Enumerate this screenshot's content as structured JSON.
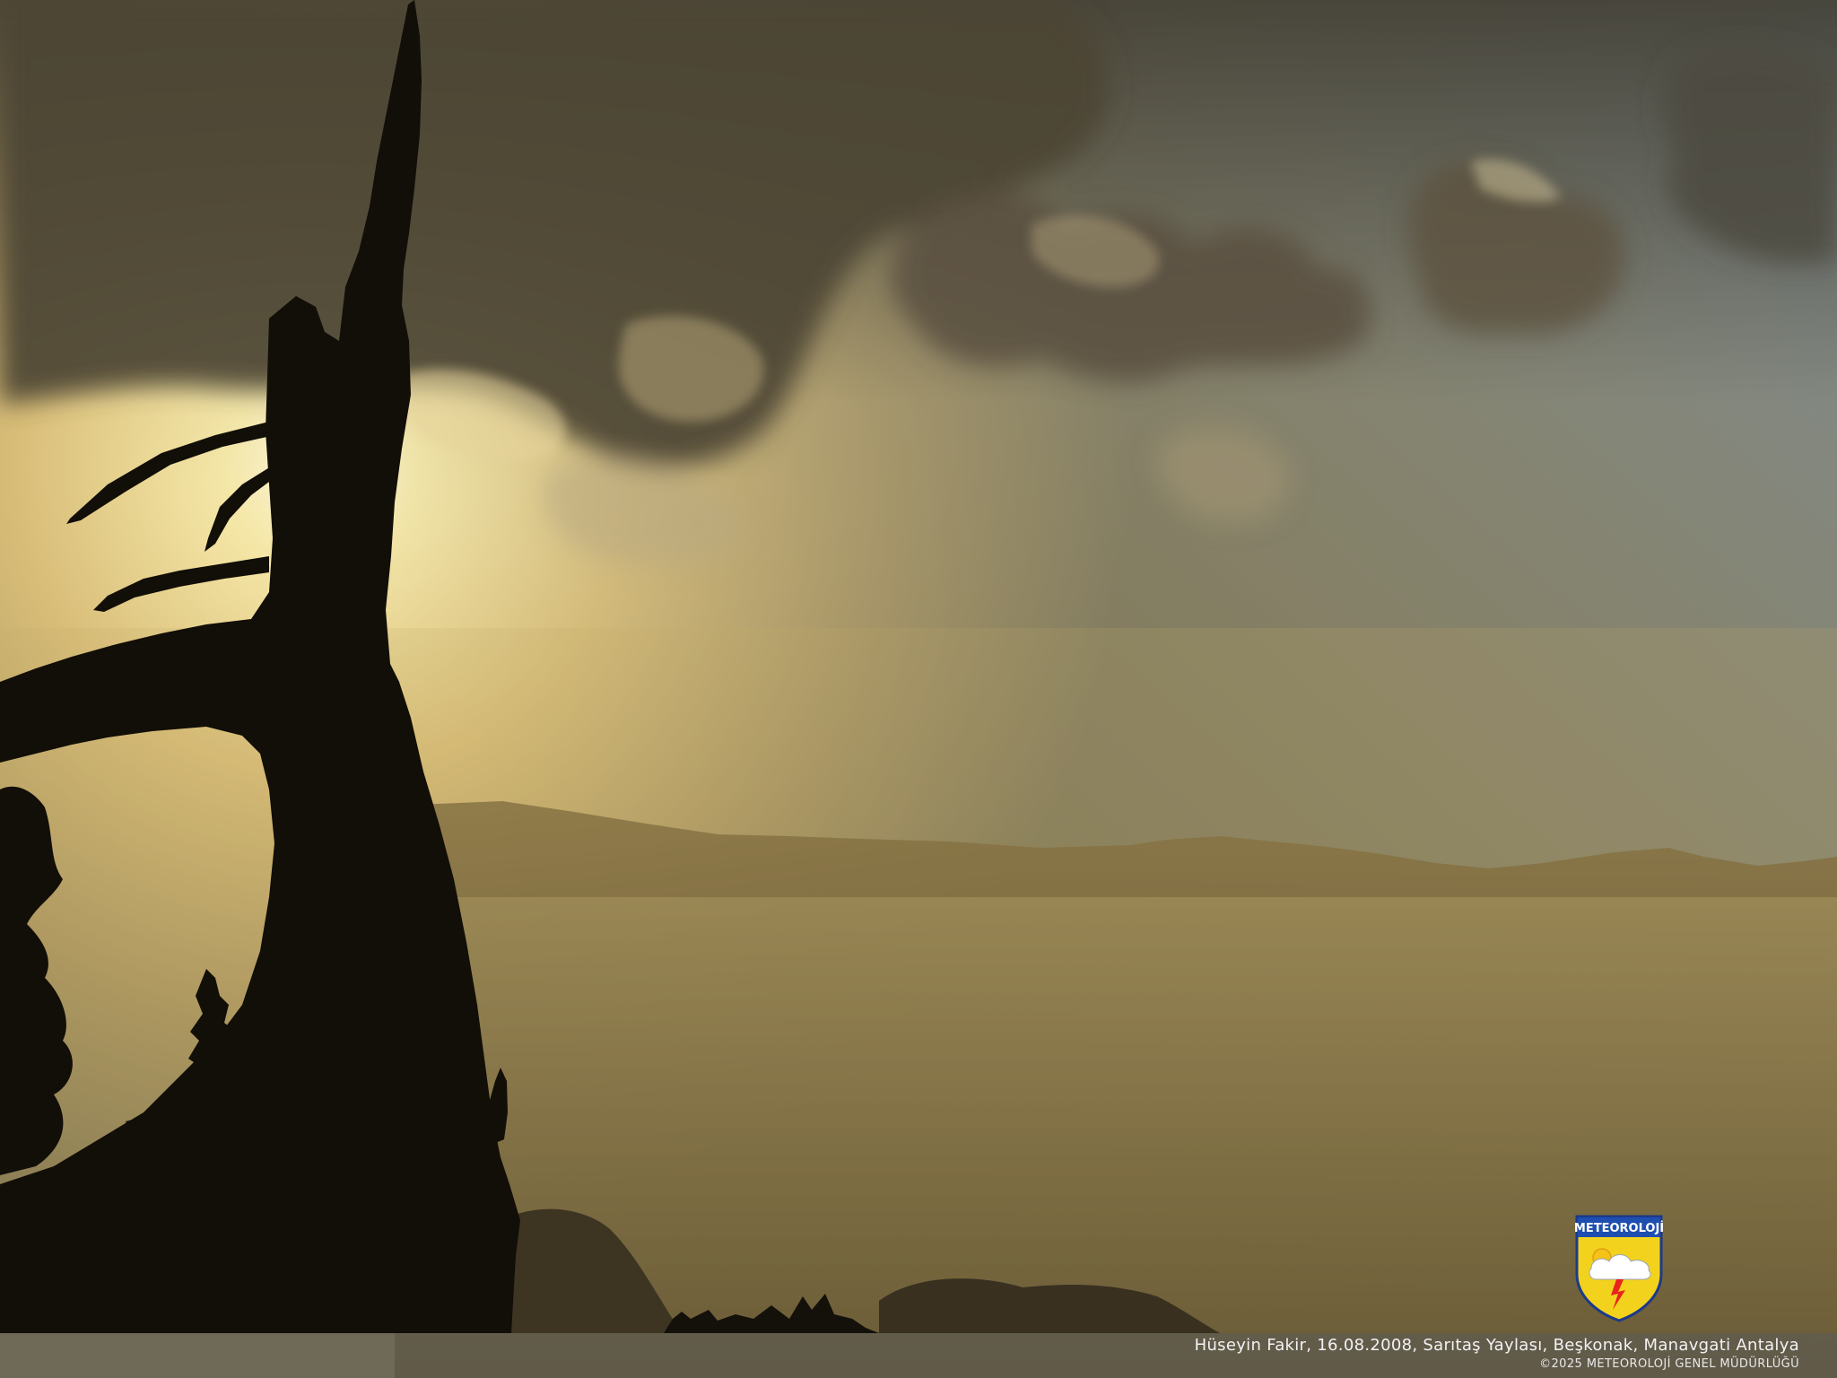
{
  "photo": {
    "subject": "sunset-silhouette-dead-tree-mountains",
    "colors": {
      "sky_top": "#4a4536",
      "sky_glow": "#f6e6a0",
      "sky_blue": "#8a9aa6",
      "haze": "#8a7a4e",
      "mountains": "#5a4c2f",
      "silhouette": "#120e08"
    }
  },
  "caption": {
    "credit": "Hüseyin Fakir, 16.08.2008, Sarıtaş Yaylası, Beşkonak, Manavgati Antalya",
    "copyright": "©2025 METEOROLOJİ GENEL MÜDÜRLÜĞÜ"
  },
  "logo": {
    "text": "METEOROLOJİ",
    "colors": {
      "top_band": "#1e4fb0",
      "shield_bottom": "#f2d21c",
      "sun": "#f5c21a",
      "bolt": "#e8241c",
      "border": "#1c3a8a"
    }
  }
}
